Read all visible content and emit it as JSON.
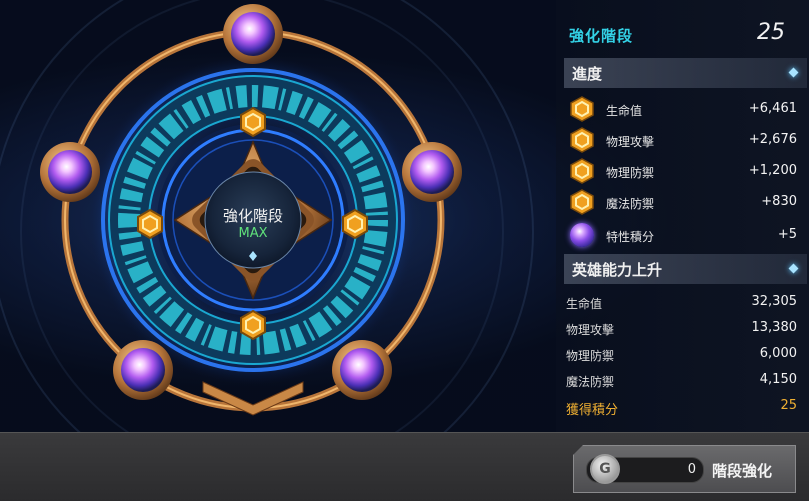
{
  "stage": {
    "title": "強化階段",
    "level": "25"
  },
  "center": {
    "title": "強化階段",
    "status": "MAX"
  },
  "progress": {
    "label": "進度",
    "items": [
      {
        "name": "生命值",
        "value": "+6,461",
        "icon": "gold-hex-icon"
      },
      {
        "name": "物理攻擊",
        "value": "+2,676",
        "icon": "gold-hex-icon"
      },
      {
        "name": "物理防禦",
        "value": "+1,200",
        "icon": "gold-hex-icon"
      },
      {
        "name": "魔法防禦",
        "value": "+830",
        "icon": "gold-hex-icon"
      },
      {
        "name": "特性積分",
        "value": "+5",
        "icon": "purple-orb-icon"
      }
    ]
  },
  "hero_ability": {
    "label": "英雄能力上升",
    "items": [
      {
        "name": "生命值",
        "value": "32,305"
      },
      {
        "name": "物理攻擊",
        "value": "13,380"
      },
      {
        "name": "物理防禦",
        "value": "6,000"
      },
      {
        "name": "魔法防禦",
        "value": "4,150"
      }
    ],
    "points_label": "獲得積分",
    "points_value": "25"
  },
  "upgrade": {
    "coin_symbol": "G",
    "cost": "0",
    "button_label": "階段強化"
  },
  "colors": {
    "accent_cyan": "#33d2e6",
    "gold": "#f0b032",
    "status_green": "#5fe07a"
  }
}
